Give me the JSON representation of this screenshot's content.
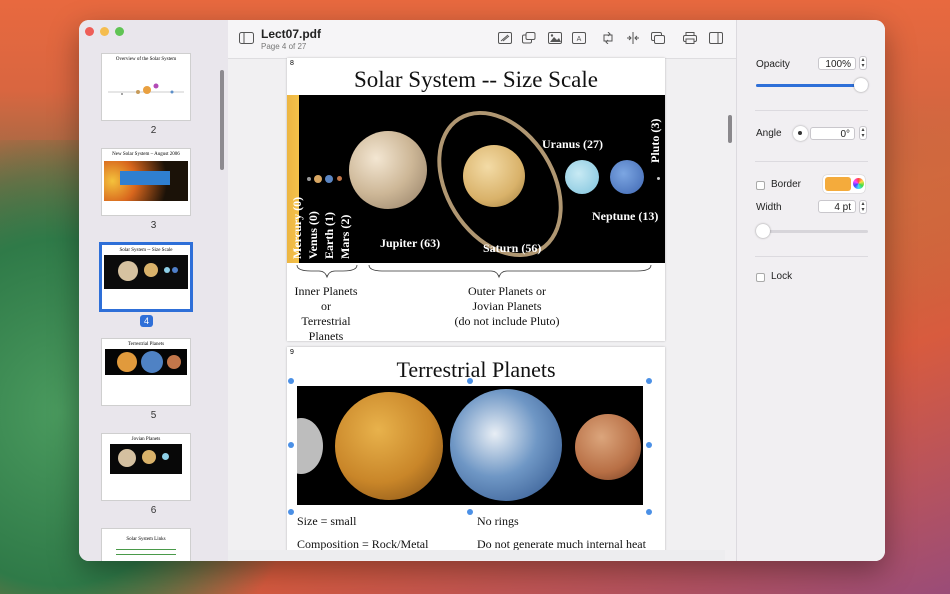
{
  "document": {
    "title": "Lect07.pdf",
    "page_info": "Page 4 of 27"
  },
  "thumbnails": [
    {
      "label": "2",
      "title": "Overview of the Solar System",
      "selected": false
    },
    {
      "label": "3",
      "title": "New Solar System – August 2006",
      "selected": false
    },
    {
      "label": "4",
      "title": "Solar System -- Size Scale",
      "selected": true
    },
    {
      "label": "5",
      "title": "Terrestrial Planets",
      "selected": false
    },
    {
      "label": "6",
      "title": "Jovian Planets",
      "selected": false
    },
    {
      "label": "",
      "title": "Solar System Links",
      "selected": false
    }
  ],
  "page8": {
    "number": "8",
    "title": "Solar System -- Size Scale",
    "planet_labels": {
      "mercury": "Mercury (0)",
      "venus": "Venus (0)",
      "earth": "Earth (1)",
      "mars": "Mars (2)",
      "jupiter": "Jupiter (63)",
      "saturn": "Saturn (56)",
      "uranus": "Uranus (27)",
      "neptune": "Neptune (13)",
      "pluto": "Pluto (3)"
    },
    "inner_caption": [
      "Inner Planets",
      "or",
      "Terrestrial",
      "Planets"
    ],
    "outer_caption": [
      "Outer Planets or",
      "Jovian Planets",
      "(do not include Pluto)"
    ]
  },
  "page9": {
    "number": "9",
    "title": "Terrestrial Planets",
    "left_col": [
      "Size = small",
      "Composition = Rock/Metal"
    ],
    "right_col": [
      "No rings",
      "Do not generate much internal heat"
    ]
  },
  "inspector": {
    "opacity_label": "Opacity",
    "opacity_value": "100%",
    "opacity_level": 1.0,
    "angle_label": "Angle",
    "angle_value": "0°",
    "border_label": "Border",
    "border_color": "#f4ab3c",
    "width_label": "Width",
    "width_value": "4 pt",
    "width_level": 0.0,
    "lock_label": "Lock"
  },
  "colors": {
    "accent": "#2e6fd8",
    "selection_handle": "#4b90e6"
  }
}
